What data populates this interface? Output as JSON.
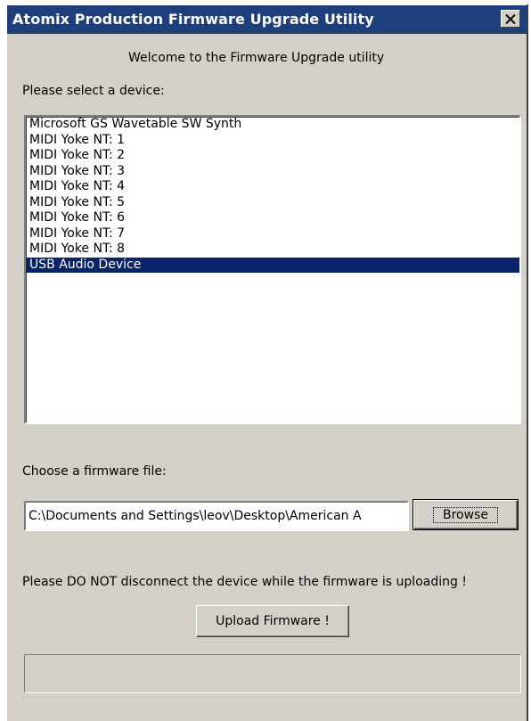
{
  "window": {
    "title": "Atomix Production Firmware Upgrade Utility",
    "close_glyph": "✕",
    "close_icon": "close-icon"
  },
  "welcome_text": "Welcome to the Firmware Upgrade utility",
  "device_select": {
    "label": "Please select a device:",
    "items": [
      "Microsoft GS Wavetable SW Synth",
      "MIDI Yoke NT:  1",
      "MIDI Yoke NT:  2",
      "MIDI Yoke NT:  3",
      "MIDI Yoke NT:  4",
      "MIDI Yoke NT:  5",
      "MIDI Yoke NT:  6",
      "MIDI Yoke NT:  7",
      "MIDI Yoke NT:  8",
      "USB Audio Device"
    ],
    "selected_index": 9,
    "selection_color": "#0a246a"
  },
  "firmware": {
    "label": "Choose a firmware file:",
    "path_value": "C:\\Documents and Settings\\leov\\Desktop\\American А",
    "browse_label": "Browse"
  },
  "warning_text": "Please DO NOT disconnect the device while the firmware is uploading !",
  "upload_label": "Upload Firmware !",
  "progress": {
    "value": 0
  }
}
